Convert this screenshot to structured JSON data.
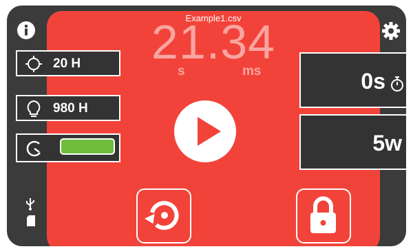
{
  "header": {
    "filename": "Example1.csv"
  },
  "timer": {
    "value": "21.34",
    "unit_seconds": "s",
    "unit_ms": "ms"
  },
  "left_panel": {
    "position_value": "20 H",
    "light_value": "980 H",
    "battery_level": 1.0
  },
  "right_panel": {
    "delay_value": "0s",
    "duration_value": "5w"
  },
  "colors": {
    "accent": "#f2433a",
    "panel": "#3b3b3b",
    "box": "#333333",
    "battery": "#6fbd3a",
    "timer_text": "#f8a5a0"
  },
  "icons": [
    "info-icon",
    "settings-gear-icon",
    "crosshair-icon",
    "lightbulb-icon",
    "battery-gauge-icon",
    "stopwatch-icon",
    "usb-icon",
    "sd-card-icon",
    "play-icon",
    "reset-icon",
    "lock-icon"
  ]
}
